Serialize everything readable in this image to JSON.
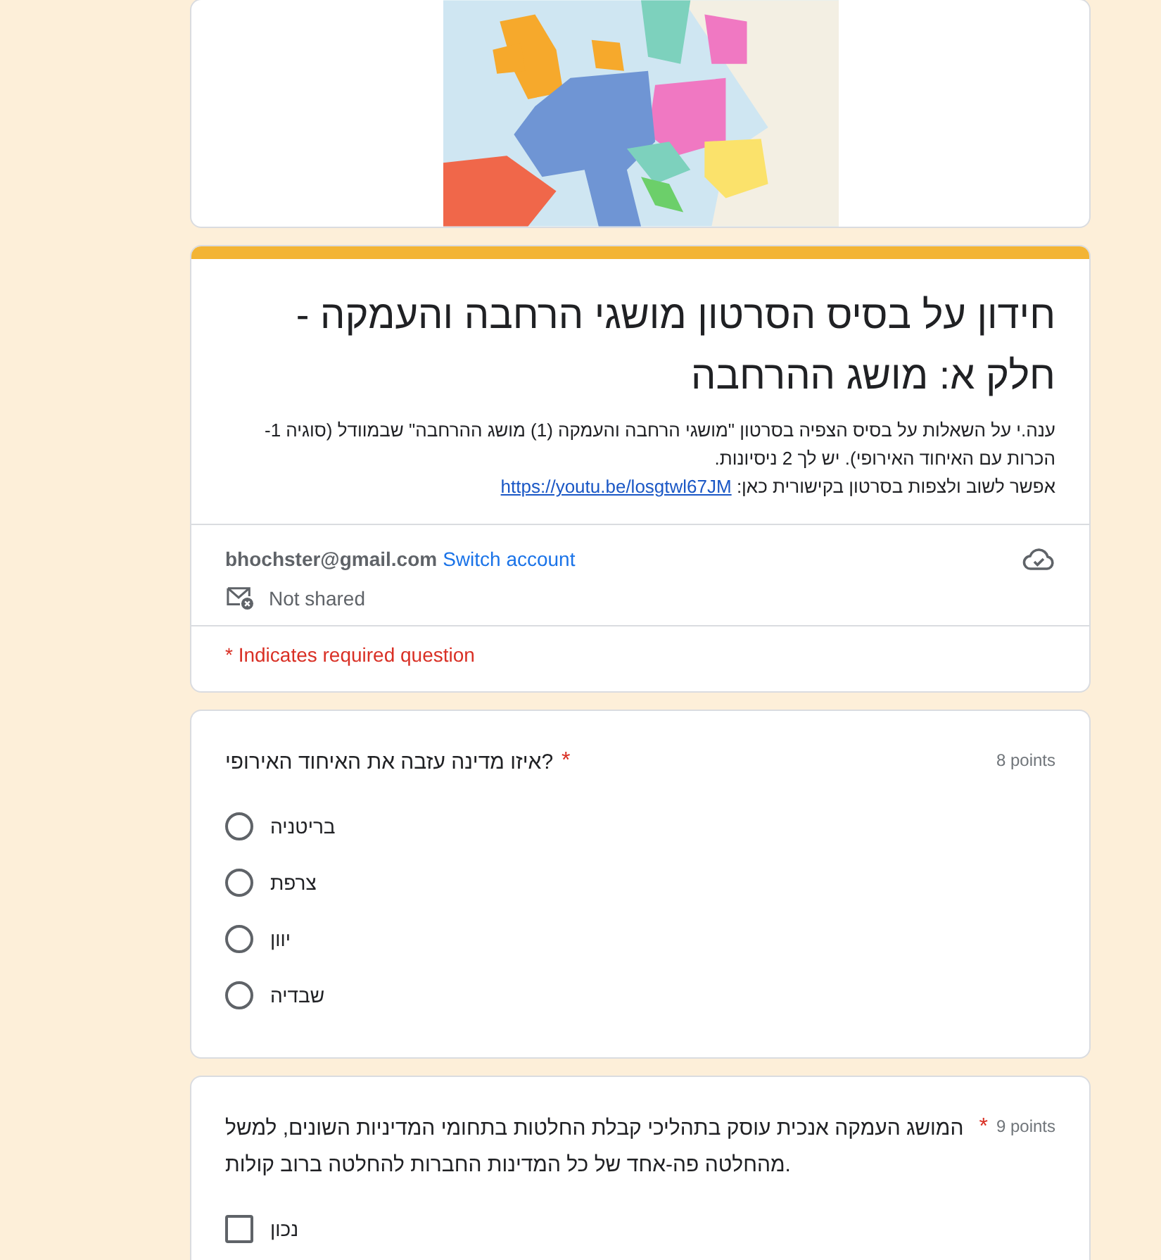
{
  "form": {
    "title": "חידון על בסיס הסרטון מושגי הרחבה והעמקה - חלק א: מושג ההרחבה",
    "description": "ענה.י על השאלות על בסיס הצפיה בסרטון \"מושגי הרחבה והעמקה (1) מושג ההרחבה\" שבמוודל (סוגיה 1- הכרות עם האיחוד האירופי). יש לך 2 ניסיונות.",
    "description_link_prefix": "אפשר לשוב ולצפות בסרטון בקישורית כאן:",
    "description_link": "https://youtu.be/losgtwl67JM",
    "account_email": "bhochster@gmail.com",
    "switch_account": "Switch account",
    "sharing": "Not shared",
    "required_note": "* Indicates required question",
    "required_mark": "*"
  },
  "questions": [
    {
      "kind": "radio",
      "text": "איזו מדינה עזבה את האיחוד האירופי?",
      "required": true,
      "points": "8 points",
      "options": [
        {
          "label": "בריטניה",
          "selected": false
        },
        {
          "label": "צרפת",
          "selected": false
        },
        {
          "label": "יוון",
          "selected": false
        },
        {
          "label": "שבדיה",
          "selected": false
        }
      ]
    },
    {
      "kind": "checkbox",
      "text": "המושג העמקה אנכית עוסק בתהליכי קבלת החלטות בתחומי המדיניות השונים, למשל מהחלטה פה-אחד של כל המדינות החברות להחלטה ברוב קולות.",
      "required": true,
      "points": "9 points",
      "options": [
        {
          "label": "נכון",
          "checked": false
        }
      ]
    }
  ]
}
